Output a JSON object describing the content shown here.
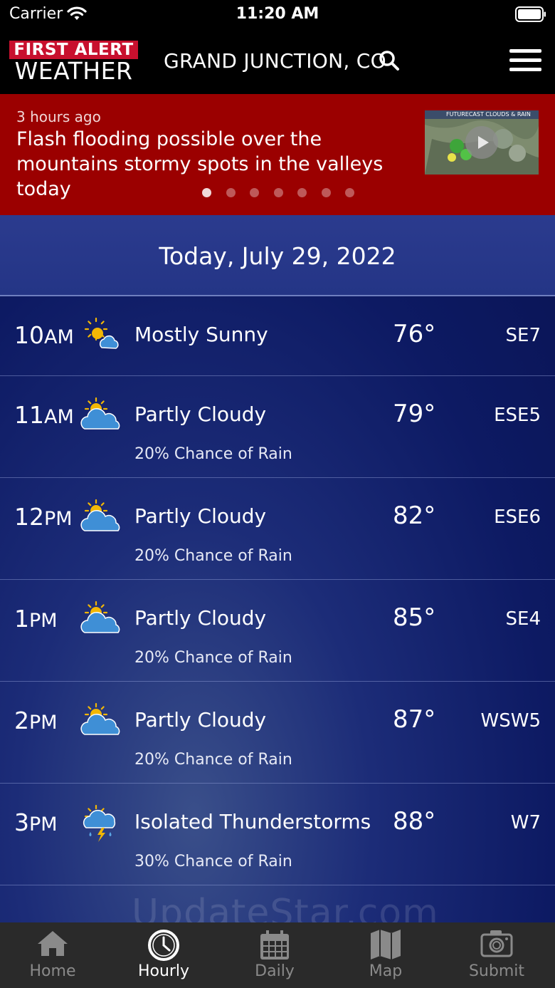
{
  "status_bar": {
    "carrier": "Carrier",
    "time": "11:20 AM"
  },
  "header": {
    "logo_top": "FIRST ALERT",
    "logo_bottom": "WEATHER",
    "location": "GRAND JUNCTION, CO",
    "brand_red": "#c8102e"
  },
  "banner": {
    "time": "3 hours ago",
    "headline": "Flash flooding possible over the mountains stormy spots in the valleys today",
    "thumbnail_caption": "FUTURECAST CLOUDS & RAIN",
    "dots_count": 7,
    "active_dot": 0,
    "background": "#9b0000"
  },
  "date_header": "Today, July 29, 2022",
  "hourly": [
    {
      "hour": "10",
      "ampm": "AM",
      "icon": "mostly-sunny-icon",
      "condition": "Mostly Sunny",
      "chance": "",
      "temp": "76°",
      "wind": "SE7"
    },
    {
      "hour": "11",
      "ampm": "AM",
      "icon": "partly-cloudy-icon",
      "condition": "Partly Cloudy",
      "chance": "20% Chance of Rain",
      "temp": "79°",
      "wind": "ESE5"
    },
    {
      "hour": "12",
      "ampm": "PM",
      "icon": "partly-cloudy-icon",
      "condition": "Partly Cloudy",
      "chance": "20% Chance of Rain",
      "temp": "82°",
      "wind": "ESE6"
    },
    {
      "hour": "1",
      "ampm": "PM",
      "icon": "partly-cloudy-icon",
      "condition": "Partly Cloudy",
      "chance": "20% Chance of Rain",
      "temp": "85°",
      "wind": "SE4"
    },
    {
      "hour": "2",
      "ampm": "PM",
      "icon": "partly-cloudy-icon",
      "condition": "Partly Cloudy",
      "chance": "20% Chance of Rain",
      "temp": "87°",
      "wind": "WSW5"
    },
    {
      "hour": "3",
      "ampm": "PM",
      "icon": "thunderstorm-icon",
      "condition": "Isolated Thunderstorms",
      "chance": "30% Chance of Rain",
      "temp": "88°",
      "wind": "W7"
    }
  ],
  "tabs": [
    {
      "label": "Home",
      "icon": "home-icon",
      "active": false
    },
    {
      "label": "Hourly",
      "icon": "clock-icon",
      "active": true
    },
    {
      "label": "Daily",
      "icon": "calendar-icon",
      "active": false
    },
    {
      "label": "Map",
      "icon": "map-icon",
      "active": false
    },
    {
      "label": "Submit",
      "icon": "camera-icon",
      "active": false
    }
  ],
  "watermark": "UpdateStar.com"
}
